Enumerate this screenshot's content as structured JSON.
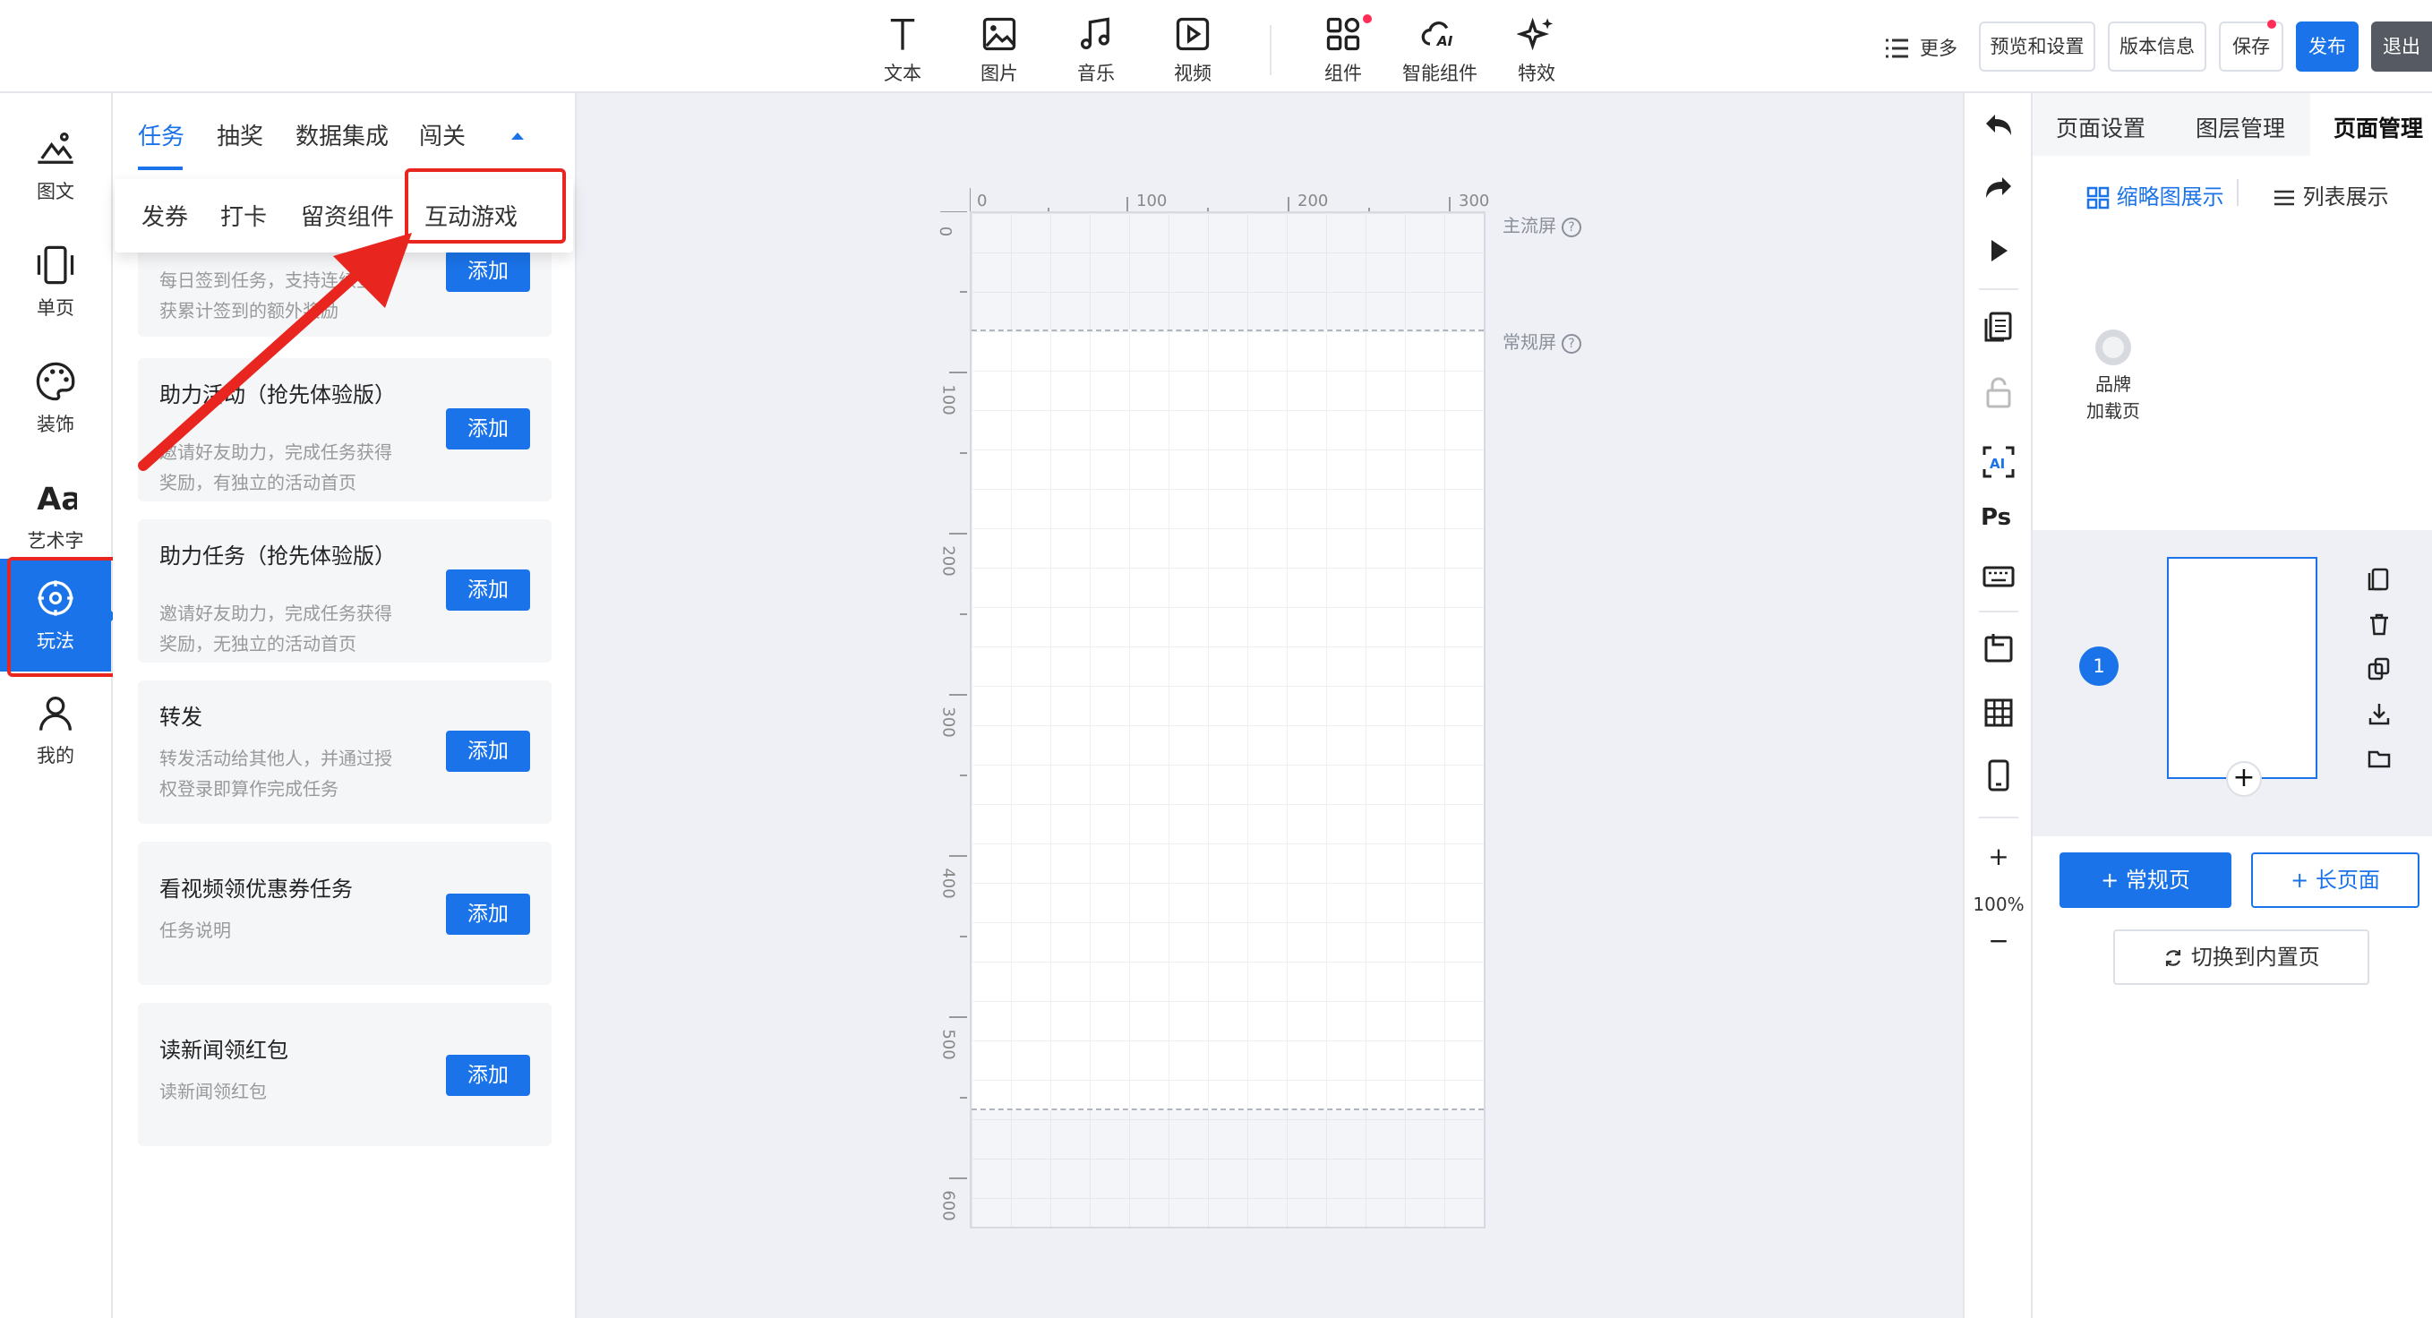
{
  "toolbar": {
    "tools": [
      {
        "label": "文本",
        "icon": "text-icon"
      },
      {
        "label": "图片",
        "icon": "image-icon"
      },
      {
        "label": "音乐",
        "icon": "music-icon"
      },
      {
        "label": "视频",
        "icon": "video-icon"
      },
      {
        "label": "组件",
        "icon": "widgets-icon"
      },
      {
        "label": "智能组件",
        "icon": "ai-cloud-icon"
      },
      {
        "label": "特效",
        "icon": "sparkle-icon"
      }
    ],
    "more": "更多",
    "preview_settings": "预览和设置",
    "version_info": "版本信息",
    "save": "保存",
    "publish": "发布",
    "exit": "退出"
  },
  "leftnav": {
    "items": [
      {
        "label": "图文",
        "icon": "landscape-icon"
      },
      {
        "label": "单页",
        "icon": "single-page-icon"
      },
      {
        "label": "装饰",
        "icon": "palette-icon"
      },
      {
        "label": "艺术字",
        "icon": "art-text-icon"
      },
      {
        "label": "玩法",
        "icon": "compass-icon"
      },
      {
        "label": "我的",
        "icon": "user-icon"
      }
    ],
    "active": "玩法"
  },
  "panel": {
    "tabs": [
      "任务",
      "抽奖",
      "数据集成",
      "闯关"
    ],
    "subtabs": [
      "发券",
      "打卡",
      "留资组件",
      "互动游戏"
    ],
    "cards": [
      {
        "title": "",
        "desc": "每日签到任务，支持连续签到获累计签到的额外奖励",
        "add": "添加"
      },
      {
        "title": "助力活动（抢先体验版）",
        "desc": "邀请好友助力，完成任务获得奖励，有独立的活动首页",
        "add": "添加"
      },
      {
        "title": "助力任务（抢先体验版）",
        "desc": "邀请好友助力，完成任务获得奖励，无独立的活动首页",
        "add": "添加"
      },
      {
        "title": "转发",
        "desc": "转发活动给其他人，并通过授权登录即算作完成任务",
        "add": "添加"
      },
      {
        "title": "看视频领优惠券任务",
        "desc": "任务说明",
        "add": "添加"
      },
      {
        "title": "读新闻领红包",
        "desc": "读新闻领红包",
        "add": "添加"
      }
    ]
  },
  "canvas": {
    "ruler_h": [
      "0",
      "100",
      "200",
      "300"
    ],
    "ruler_v": [
      "0",
      "100",
      "200",
      "300",
      "400",
      "500",
      "600"
    ],
    "main_screen_label": "主流屏",
    "regular_screen_label": "常规屏",
    "help": "?"
  },
  "toolcol": {
    "zoom_in": "+",
    "zoom": "100%",
    "zoom_out": "−"
  },
  "rpanel": {
    "tabs": [
      "页面设置",
      "图层管理",
      "页面管理"
    ],
    "view_thumb": "缩略图展示",
    "view_list": "列表展示",
    "brand_loading": "品牌\n加载页",
    "brand_line1": "品牌",
    "brand_line2": "加载页",
    "page_number": "1",
    "add_page_plus": "+",
    "add_regular": "+ 常规页",
    "add_long": "+ 长页面",
    "switch_inner": "切换到内置页"
  },
  "colors": {
    "accent": "#1a73e8",
    "highlight": "#e8251f"
  }
}
